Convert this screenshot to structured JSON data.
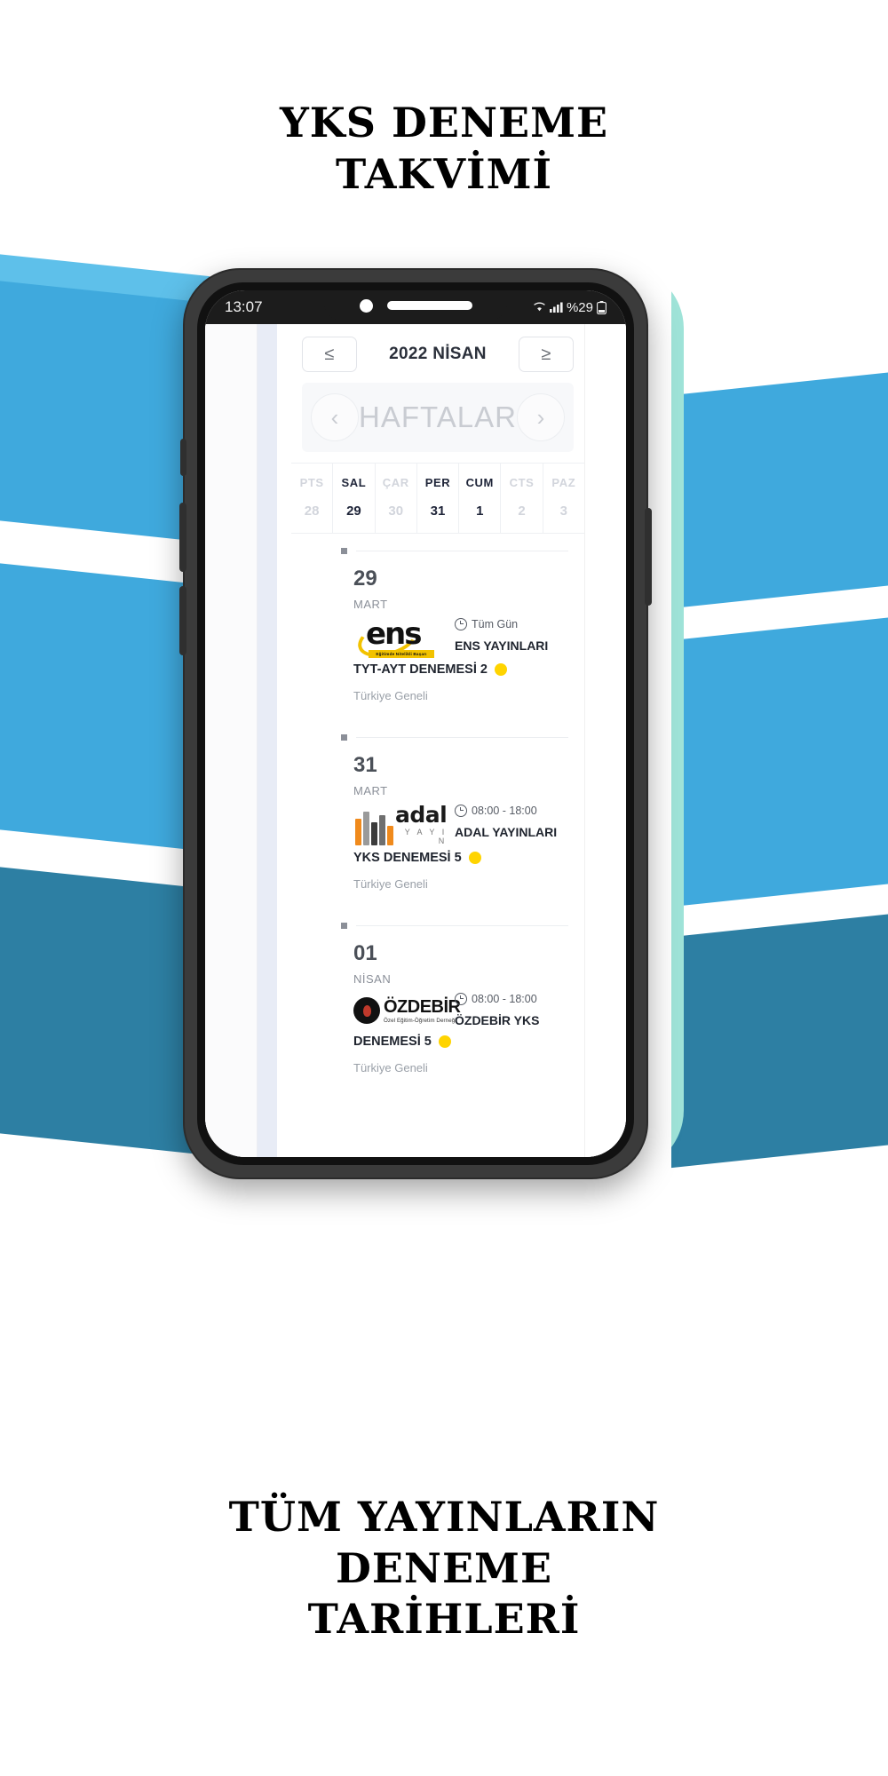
{
  "poster": {
    "title_top": "YKS DENEME\nTAKVİMİ",
    "title_bottom": "TÜM YAYINLARIN\nDENEME\nTARİHLERİ"
  },
  "phone": {
    "status_bar": {
      "time": "13:07",
      "wifi_icon": "wifi-icon",
      "signal_icon": "signal-bars-icon",
      "battery_text": "%29",
      "battery_icon": "battery-icon"
    }
  },
  "app": {
    "month_nav": {
      "prev_label": "≤",
      "next_label": "≥",
      "month_label": "2022 NİSAN"
    },
    "week_nav": {
      "prev_label": "‹",
      "next_label": "›",
      "label": "HAFTALAR 1"
    },
    "weekdays": [
      {
        "name": "PTS",
        "num": "28",
        "active": false
      },
      {
        "name": "SAL",
        "num": "29",
        "active": true
      },
      {
        "name": "ÇAR",
        "num": "30",
        "active": false
      },
      {
        "name": "PER",
        "num": "31",
        "active": true
      },
      {
        "name": "CUM",
        "num": "1",
        "active": true
      },
      {
        "name": "CTS",
        "num": "2",
        "active": false
      },
      {
        "name": "PAZ",
        "num": "3",
        "active": false
      }
    ],
    "events": [
      {
        "day": "29",
        "month": "MART",
        "logo": "ens-logo",
        "logo_text": "ens",
        "logo_tagline": "Eğitimde Nitelikli Başarı",
        "time": "Tüm Gün",
        "publisher": "ENS YAYINLARI",
        "title": "TYT-AYT DENEMESİ 2",
        "scope": "Türkiye Geneli",
        "dot_color": "#ffd400"
      },
      {
        "day": "31",
        "month": "MART",
        "logo": "adal-logo",
        "logo_text": "adal",
        "logo_tagline": "Y A Y I N",
        "time": "08:00 - 18:00",
        "publisher": "ADAL YAYINLARI",
        "title": "YKS DENEMESİ 5",
        "scope": "Türkiye Geneli",
        "dot_color": "#ffd400"
      },
      {
        "day": "01",
        "month": "NİSAN",
        "logo": "ozdebir-logo",
        "logo_text": "ÖZDEBİR",
        "logo_tagline": "Özel Eğitim-Öğretim Derneği",
        "time": "08:00 - 18:00",
        "publisher": "ÖZDEBİR YKS",
        "title": "DENEMESİ 5",
        "scope": "Türkiye Geneli",
        "dot_color": "#ffd400"
      }
    ]
  },
  "colors": {
    "accent_blue": "#3fa9dd",
    "deep_blue": "#2d7fa3",
    "mint": "#9fe3d8",
    "event_dot": "#ffd400",
    "logo_yellow": "#f2c200",
    "logo_orange": "#f08a1c"
  }
}
